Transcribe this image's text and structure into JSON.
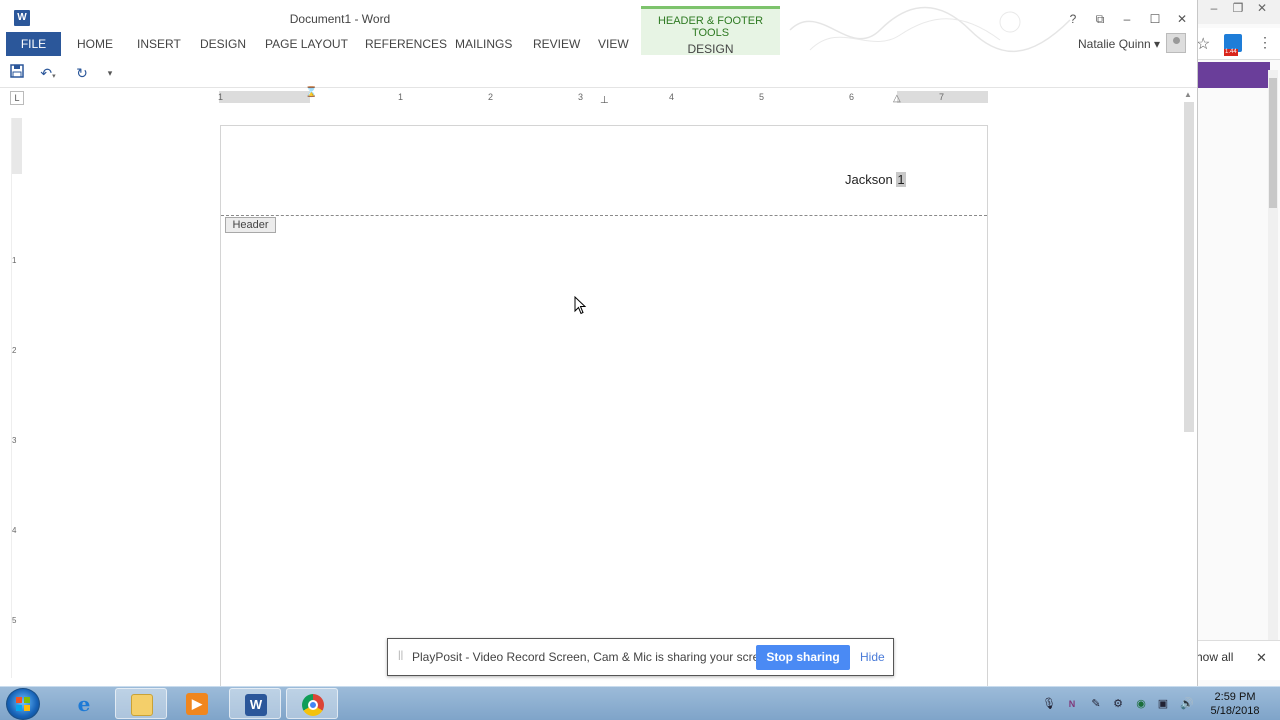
{
  "window": {
    "title": "Document1 - Word"
  },
  "contextual_tab": {
    "group_label": "HEADER & FOOTER TOOLS",
    "tab_label": "DESIGN"
  },
  "ribbon_tabs": [
    {
      "label": "FILE"
    },
    {
      "label": "HOME"
    },
    {
      "label": "INSERT"
    },
    {
      "label": "DESIGN"
    },
    {
      "label": "PAGE LAYOUT"
    },
    {
      "label": "REFERENCES"
    },
    {
      "label": "MAILINGS"
    },
    {
      "label": "REVIEW"
    },
    {
      "label": "VIEW"
    }
  ],
  "user": {
    "name": "Natalie Quinn"
  },
  "window_buttons": {
    "help": "?",
    "restore_ribbon": "⧉",
    "minimize": "–",
    "maximize": "☐",
    "close": "✕"
  },
  "qat": {
    "save": "save-icon",
    "undo": "undo-icon",
    "redo": "redo-icon",
    "customize": "customize-icon"
  },
  "ruler": {
    "tab_selector": "L",
    "h_numbers": [
      "1",
      "1",
      "2",
      "3",
      "4",
      "5",
      "6",
      "7"
    ],
    "v_numbers": [
      "1",
      "2",
      "3",
      "4",
      "5"
    ]
  },
  "document": {
    "header_text": "Jackson ",
    "page_number": "1",
    "header_tag": "Header"
  },
  "share_bar": {
    "message": "PlayPosit - Video Record Screen, Cam & Mic is sharing your screen.",
    "stop_label": "Stop sharing",
    "hide_label": "Hide"
  },
  "background_browser": {
    "show_all": "how all",
    "close": "✕",
    "badge": "1.44"
  },
  "taskbar": {
    "apps": [
      "internet-explorer",
      "file-explorer",
      "media-player",
      "word",
      "chrome"
    ],
    "time": "2:59 PM",
    "date": "5/18/2018"
  },
  "colors": {
    "word_blue": "#2b579a",
    "hf_green": "#7dc36c",
    "share_blue": "#4a8af4",
    "chrome_purple": "#6a3e9a"
  }
}
